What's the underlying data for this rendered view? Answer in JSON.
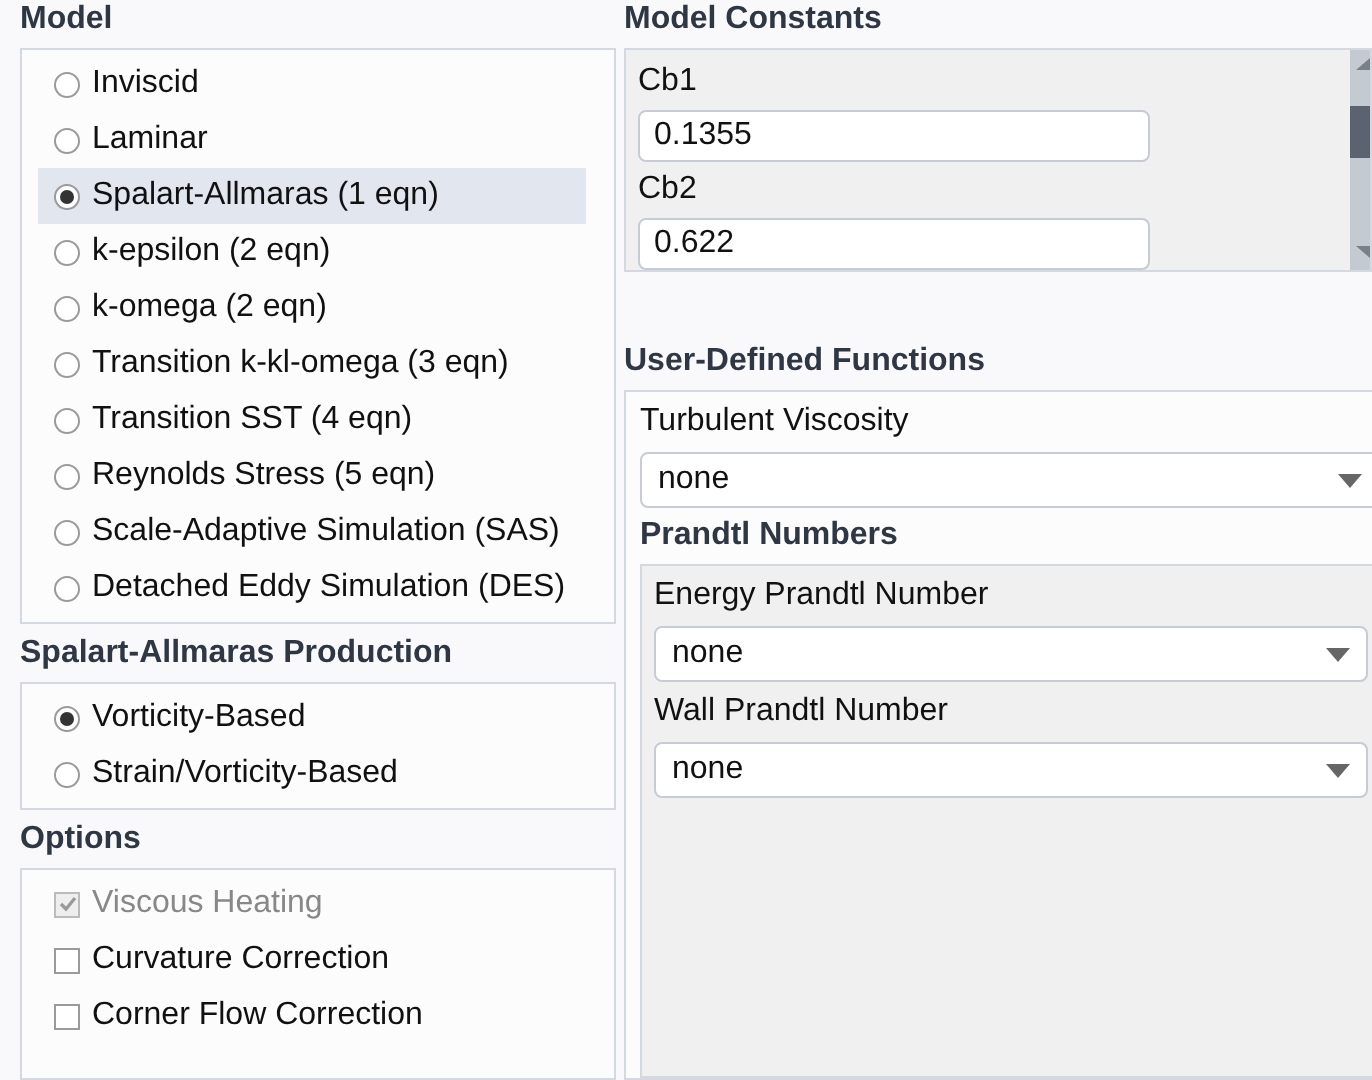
{
  "model": {
    "title": "Model",
    "options": [
      {
        "label": "Inviscid",
        "selected": false
      },
      {
        "label": "Laminar",
        "selected": false
      },
      {
        "label": "Spalart-Allmaras (1 eqn)",
        "selected": true
      },
      {
        "label": "k-epsilon (2 eqn)",
        "selected": false
      },
      {
        "label": "k-omega (2 eqn)",
        "selected": false
      },
      {
        "label": "Transition k-kl-omega (3 eqn)",
        "selected": false
      },
      {
        "label": "Transition SST (4 eqn)",
        "selected": false
      },
      {
        "label": "Reynolds Stress (5 eqn)",
        "selected": false
      },
      {
        "label": "Scale-Adaptive Simulation (SAS)",
        "selected": false
      },
      {
        "label": "Detached Eddy Simulation (DES)",
        "selected": false
      }
    ]
  },
  "production": {
    "title": "Spalart-Allmaras Production",
    "options": [
      {
        "label": "Vorticity-Based",
        "selected": true
      },
      {
        "label": "Strain/Vorticity-Based",
        "selected": false
      }
    ]
  },
  "options": {
    "title": "Options",
    "items": [
      {
        "label": "Viscous Heating",
        "checked": true,
        "disabled": true
      },
      {
        "label": "Curvature Correction",
        "checked": false,
        "disabled": false
      },
      {
        "label": "Corner Flow Correction",
        "checked": false,
        "disabled": false
      }
    ]
  },
  "model_constants": {
    "title": "Model Constants",
    "fields": [
      {
        "label": "Cb1",
        "value": "0.1355"
      },
      {
        "label": "Cb2",
        "value": "0.622"
      }
    ]
  },
  "udf": {
    "title": "User-Defined Functions",
    "turbulent_viscosity": {
      "label": "Turbulent Viscosity",
      "value": "none"
    },
    "prandtl": {
      "title": "Prandtl Numbers",
      "fields": [
        {
          "label": "Energy Prandtl Number",
          "value": "none"
        },
        {
          "label": "Wall Prandtl Number",
          "value": "none"
        }
      ]
    }
  }
}
